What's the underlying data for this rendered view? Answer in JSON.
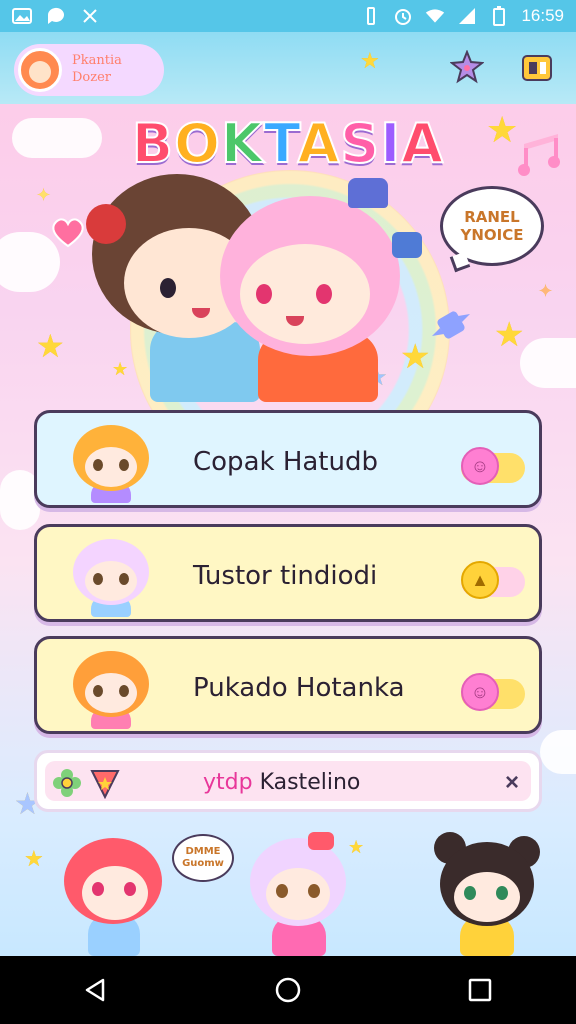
{
  "status_bar": {
    "time": "16:59",
    "left_icons": [
      "gallery-icon",
      "chat-icon",
      "sync-icon"
    ],
    "right_icons": [
      "vibrate-icon",
      "alarm-icon",
      "wifi-icon",
      "signal-icon",
      "battery-icon"
    ]
  },
  "app_bar": {
    "profile_line1": "Pkantia",
    "profile_line2": "Dozer",
    "right_icons": [
      "star-badge-icon",
      "menu-card-icon"
    ]
  },
  "title": {
    "letters": [
      "B",
      "O",
      "K",
      "T",
      "A",
      "S",
      "I",
      "A"
    ],
    "colors": [
      "#ff4d6d",
      "#ffb020",
      "#4cc76a",
      "#3aa9ff",
      "#ffb020",
      "#ff5fa8",
      "#9d5cff",
      "#ff4d6d"
    ]
  },
  "hero_bubble": {
    "line1": "RANEL",
    "line2": "YNOICE"
  },
  "cards": [
    {
      "label": "Copak Hatudb",
      "color": "#dff5ff",
      "toggle_icon": "smiley-icon"
    },
    {
      "label": "Tustor tindiodi",
      "color": "#fff7c4",
      "toggle_icon": "bell-icon"
    },
    {
      "label": "Pukado Hotanka",
      "color": "#fff7c4",
      "toggle_icon": "smiley-icon"
    }
  ],
  "search": {
    "prefix": "ytdp",
    "text": "Kastelino",
    "close": "×"
  },
  "bottom_bubble": {
    "line1": "DMME",
    "line2": "Guomw"
  },
  "colors": {
    "accent_pink": "#e8379a",
    "status_bar": "#55c6e8",
    "outline": "#4a3b5c"
  }
}
